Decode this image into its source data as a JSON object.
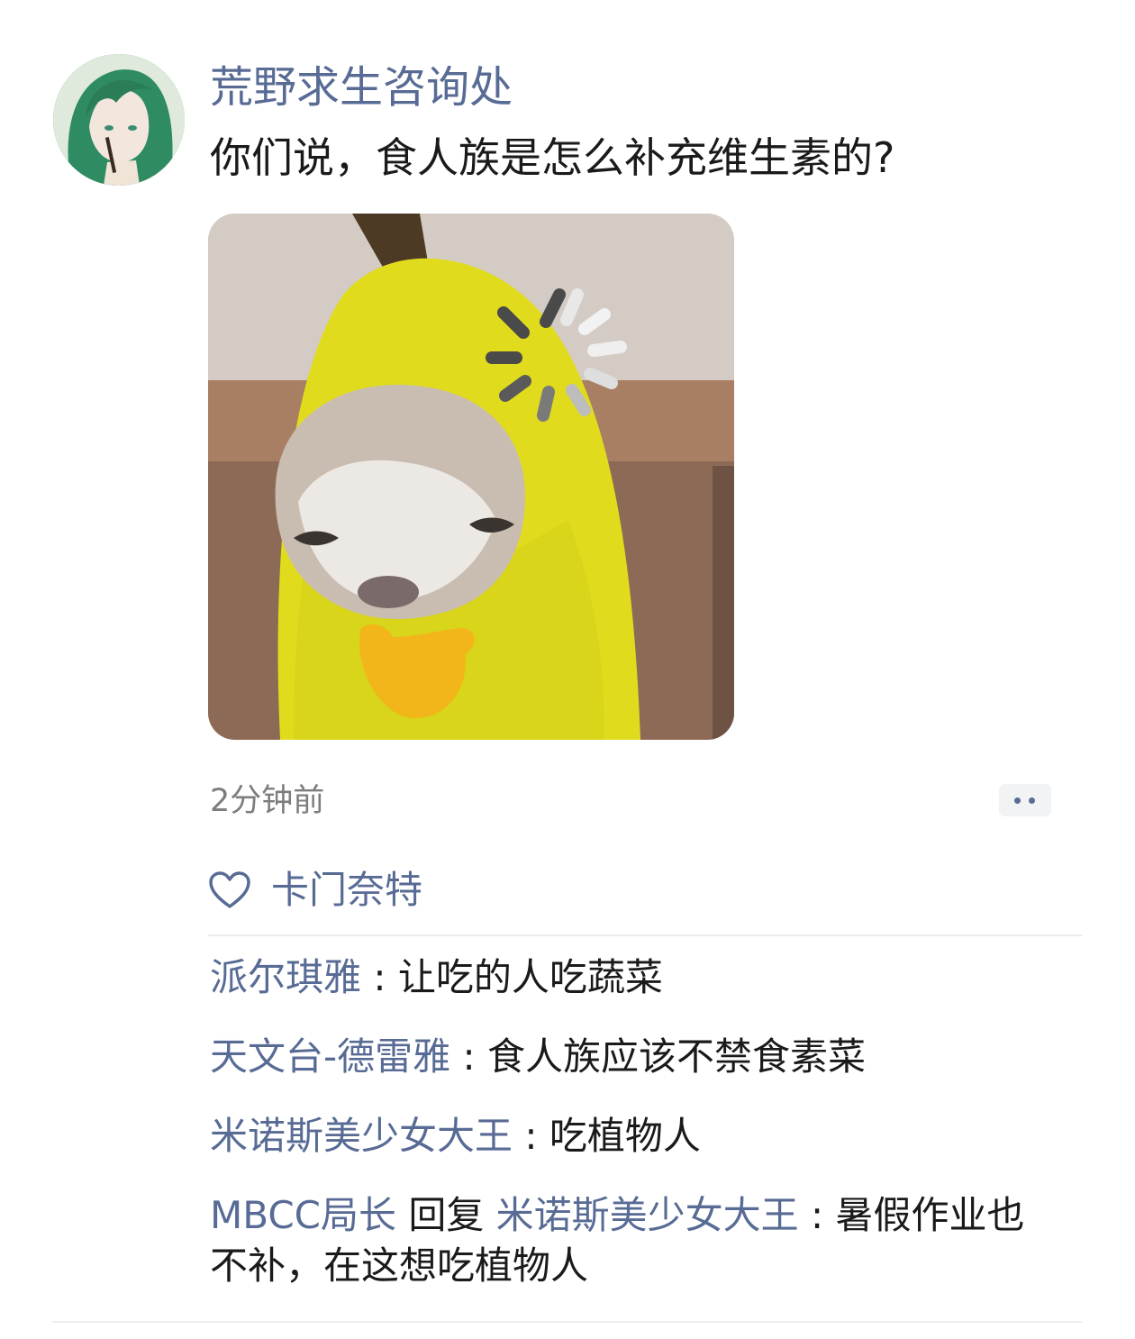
{
  "post": {
    "author": "荒野求生咨询处",
    "text": "你们说，食人族是怎么补充维生素的?",
    "time": "2分钟前"
  },
  "likes": {
    "names": "卡门奈特"
  },
  "comments": [
    {
      "user": "派尔琪雅",
      "separator": " : ",
      "text": "让吃的人吃蔬菜"
    },
    {
      "user": "天文台-德雷雅",
      "separator": " : ",
      "text": "食人族应该不禁食素菜"
    },
    {
      "user": "米诺斯美少女大王",
      "separator": " : ",
      "text": "吃植物人"
    },
    {
      "user": "MBCC局长",
      "reply_word": " 回复 ",
      "reply_to": "米诺斯美少女大王",
      "separator": " : ",
      "text": "暑假作业也不补，在这想吃植物人"
    }
  ],
  "colors": {
    "link": "#586b95",
    "text": "#1a1a1a",
    "meta": "#7d7d7d"
  },
  "icons": {
    "like": "heart-icon",
    "more": "more-dots-icon"
  }
}
